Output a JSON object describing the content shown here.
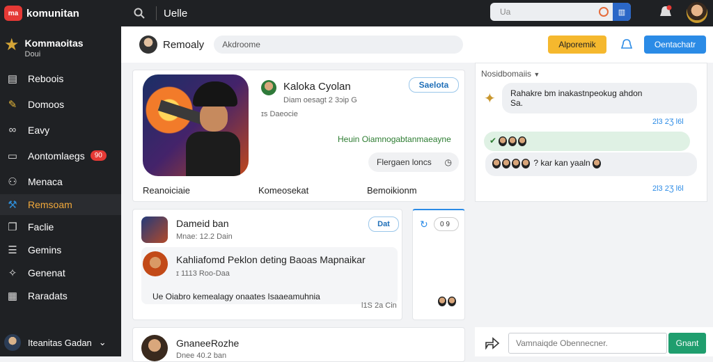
{
  "topbar": {
    "brand_logo": "ma",
    "brand_name": "komunitan",
    "title": "Uelle",
    "search_placeholder": "Ua",
    "search_action_icon": "grid-icon"
  },
  "sidebar": {
    "header": {
      "title": "Kommaoitas",
      "subtitle": "Doui"
    },
    "items": [
      {
        "label": "Reboois",
        "icon": "document-icon"
      },
      {
        "label": "Domoos",
        "icon": "pencil-icon"
      },
      {
        "label": "Eavy",
        "icon": "link-icon"
      },
      {
        "label": "Aontomlaegs",
        "icon": "inbox-icon",
        "badge": "90"
      },
      {
        "label": "Menaca",
        "icon": "people-icon"
      },
      {
        "label": "Remsoam",
        "icon": "wrench-icon",
        "active": true
      },
      {
        "label": "Faclie",
        "icon": "copy-icon"
      },
      {
        "label": "Gemins",
        "icon": "list-icon"
      },
      {
        "label": "Genenat",
        "icon": "pin-icon"
      },
      {
        "label": "Raradats",
        "icon": "chart-icon"
      }
    ],
    "footer": {
      "label": "Iteanitas Gadan"
    }
  },
  "header": {
    "name": "Remoaly",
    "input_value": "Akdroome",
    "yellow_button": "Alporemik",
    "blue_button": "Oentachatr"
  },
  "game_card": {
    "title": "Kaloka Cyolan",
    "meta": "Diam oesagt 2 3ɔip  G",
    "sub": "ɪs  Daeocie",
    "pill": "Saelota",
    "green_text": "Heuin Oiamnogabtanmaeayne",
    "gray_pill": "Flergaen loncs",
    "tabs": [
      "Reanoiciaie",
      "Komeosekat",
      "Bemoikionm"
    ]
  },
  "post_card": {
    "title": "Dameid ban",
    "meta": "Mnae:  12.2  Dain",
    "pill": "Dat",
    "headline": "Kahliafomd Peklon deting Baoas Mapnaikar",
    "sub_meta": "ɪ 1113  Roo-Daa",
    "comment": "Ue  Oiabro kemealagy onaates Isaaeamuhnia",
    "comment_time": "Ɩ1S  2a Cin"
  },
  "side_small": {
    "pill": "0 9"
  },
  "bottom_card": {
    "title": "GnaneeRozhe",
    "meta": "Dnee 40.2  ban"
  },
  "chat": {
    "header": "Nosidbomaiis",
    "msg1": "Rahakre bm inakastnpeokug ahdon",
    "msg1_sub": "Sa.",
    "time1": "2Ɩ3  2Ʒ  Ɩ6Ɩ",
    "msg3": "? kar kan yaaln",
    "time2": "2Ɩ3  2Ʒ  Ɩ6Ɩ"
  },
  "composer": {
    "placeholder": "Vamnaiqde Obennecner.",
    "send": "Gnant"
  }
}
